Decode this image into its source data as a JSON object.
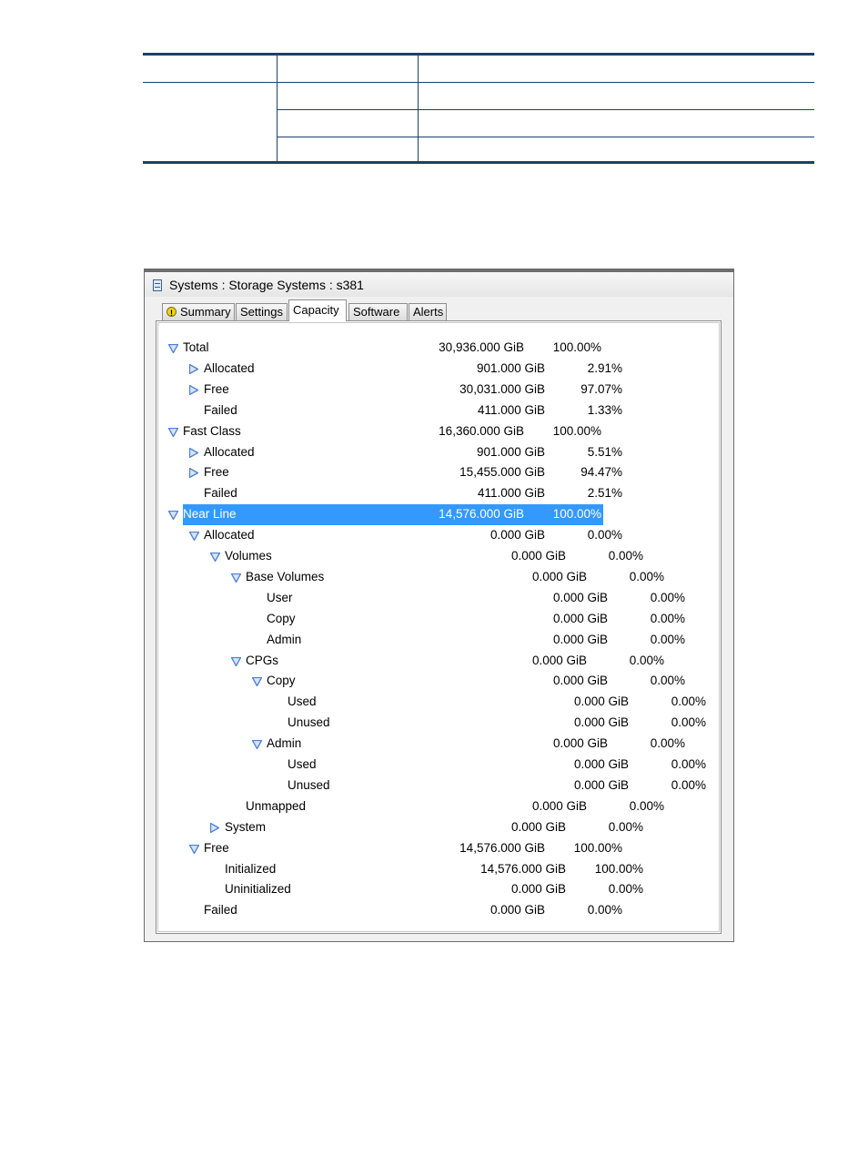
{
  "window": {
    "title": "Systems : Storage Systems : s381"
  },
  "tabs": [
    {
      "label": "Summary",
      "icon": "warning-icon"
    },
    {
      "label": "Settings"
    },
    {
      "label": "Capacity",
      "active": true
    },
    {
      "label": "Software"
    },
    {
      "label": "Alerts"
    }
  ],
  "capacity_tree": [
    {
      "label": "Total",
      "value": "30,936.000 GiB",
      "percent": "100.00%",
      "depth": 0,
      "expander": "expanded"
    },
    {
      "label": "Allocated",
      "value": "901.000 GiB",
      "percent": "2.91%",
      "depth": 1,
      "expander": "collapsed"
    },
    {
      "label": "Free",
      "value": "30,031.000 GiB",
      "percent": "97.07%",
      "depth": 1,
      "expander": "collapsed"
    },
    {
      "label": "Failed",
      "value": "411.000 GiB",
      "percent": "1.33%",
      "depth": 1,
      "expander": "none"
    },
    {
      "label": "Fast Class",
      "value": "16,360.000 GiB",
      "percent": "100.00%",
      "depth": 0,
      "expander": "expanded"
    },
    {
      "label": "Allocated",
      "value": "901.000 GiB",
      "percent": "5.51%",
      "depth": 1,
      "expander": "collapsed"
    },
    {
      "label": "Free",
      "value": "15,455.000 GiB",
      "percent": "94.47%",
      "depth": 1,
      "expander": "collapsed"
    },
    {
      "label": "Failed",
      "value": "411.000 GiB",
      "percent": "2.51%",
      "depth": 1,
      "expander": "none"
    },
    {
      "label": "Near Line",
      "value": "14,576.000 GiB",
      "percent": "100.00%",
      "depth": 0,
      "expander": "expanded",
      "selected": true
    },
    {
      "label": "Allocated",
      "value": "0.000 GiB",
      "percent": "0.00%",
      "depth": 1,
      "expander": "expanded"
    },
    {
      "label": "Volumes",
      "value": "0.000 GiB",
      "percent": "0.00%",
      "depth": 2,
      "expander": "expanded"
    },
    {
      "label": "Base Volumes",
      "value": "0.000 GiB",
      "percent": "0.00%",
      "depth": 3,
      "expander": "expanded"
    },
    {
      "label": "User",
      "value": "0.000 GiB",
      "percent": "0.00%",
      "depth": 4,
      "expander": "none"
    },
    {
      "label": "Copy",
      "value": "0.000 GiB",
      "percent": "0.00%",
      "depth": 4,
      "expander": "none"
    },
    {
      "label": "Admin",
      "value": "0.000 GiB",
      "percent": "0.00%",
      "depth": 4,
      "expander": "none"
    },
    {
      "label": "CPGs",
      "value": "0.000 GiB",
      "percent": "0.00%",
      "depth": 3,
      "expander": "expanded"
    },
    {
      "label": "Copy",
      "value": "0.000 GiB",
      "percent": "0.00%",
      "depth": 4,
      "expander": "expanded"
    },
    {
      "label": "Used",
      "value": "0.000 GiB",
      "percent": "0.00%",
      "depth": 5,
      "expander": "none"
    },
    {
      "label": "Unused",
      "value": "0.000 GiB",
      "percent": "0.00%",
      "depth": 5,
      "expander": "none"
    },
    {
      "label": "Admin",
      "value": "0.000 GiB",
      "percent": "0.00%",
      "depth": 4,
      "expander": "expanded"
    },
    {
      "label": "Used",
      "value": "0.000 GiB",
      "percent": "0.00%",
      "depth": 5,
      "expander": "none"
    },
    {
      "label": "Unused",
      "value": "0.000 GiB",
      "percent": "0.00%",
      "depth": 5,
      "expander": "none"
    },
    {
      "label": "Unmapped",
      "value": "0.000 GiB",
      "percent": "0.00%",
      "depth": 3,
      "expander": "none"
    },
    {
      "label": "System",
      "value": "0.000 GiB",
      "percent": "0.00%",
      "depth": 2,
      "expander": "collapsed"
    },
    {
      "label": "Free",
      "value": "14,576.000 GiB",
      "percent": "100.00%",
      "depth": 1,
      "expander": "expanded"
    },
    {
      "label": "Initialized",
      "value": "14,576.000 GiB",
      "percent": "100.00%",
      "depth": 2,
      "expander": "none"
    },
    {
      "label": "Uninitialized",
      "value": "0.000 GiB",
      "percent": "0.00%",
      "depth": 2,
      "expander": "none"
    },
    {
      "label": "Failed",
      "value": "0.000 GiB",
      "percent": "0.00%",
      "depth": 1,
      "expander": "none"
    }
  ],
  "colors": {
    "selection": "#3399ff",
    "expander": "#4d7fd6",
    "table_rule": "#1f3f66"
  }
}
